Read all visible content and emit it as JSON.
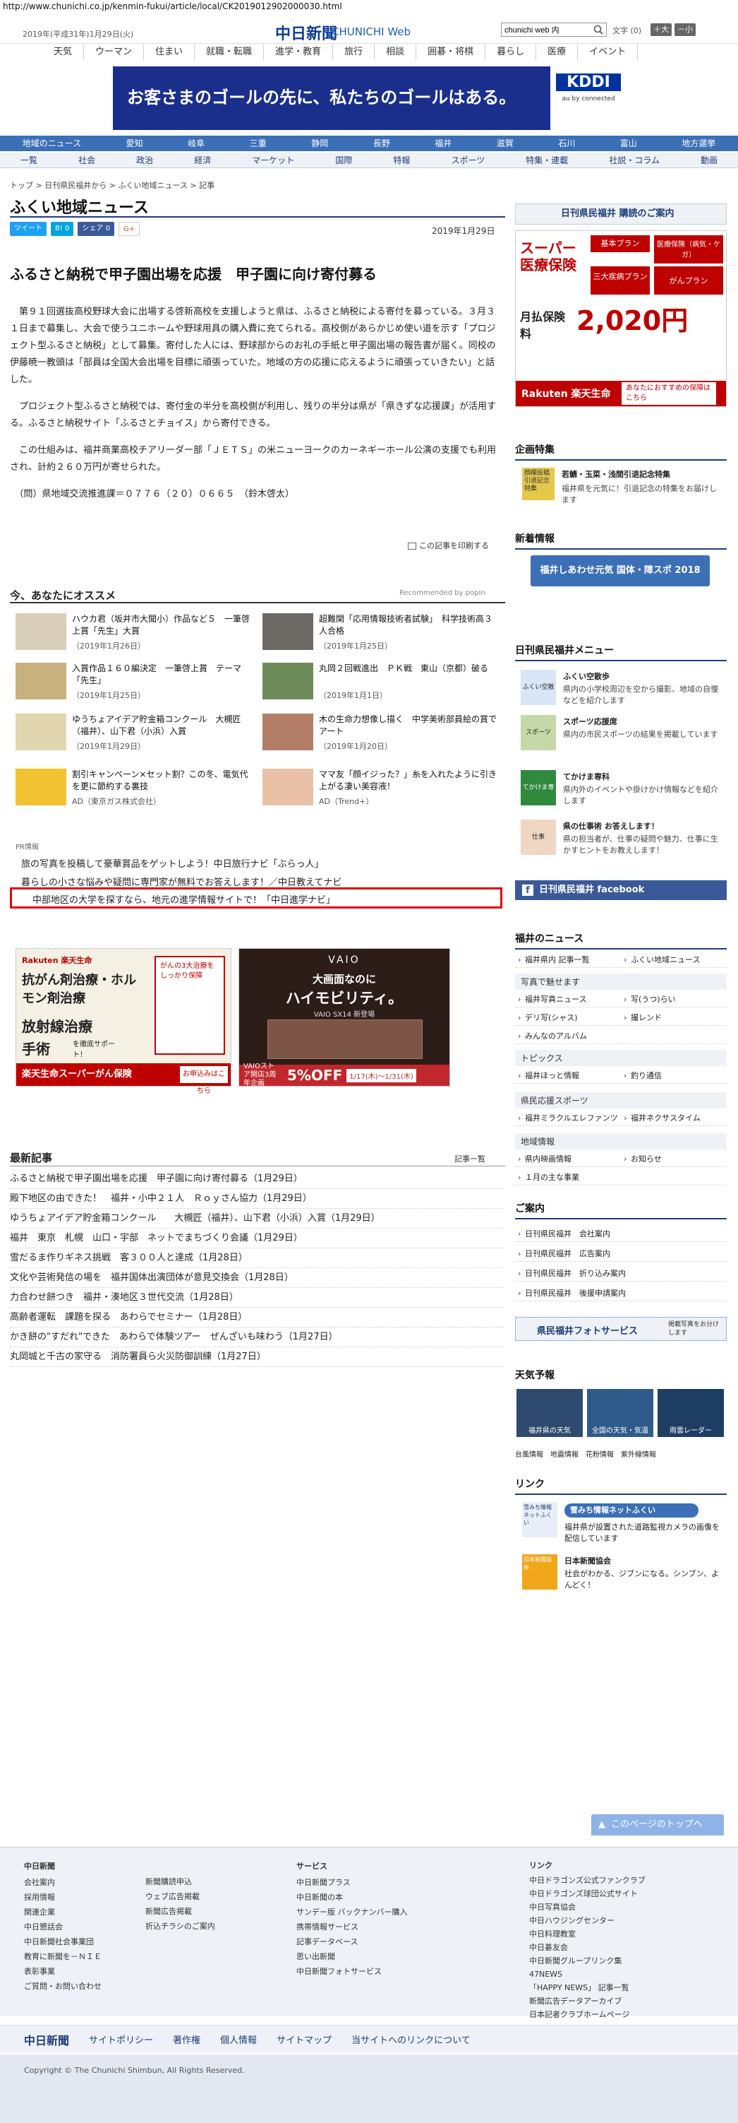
{
  "browser": {
    "url": "http://www.chunichi.co.jp/kenmin-fukui/article/local/CK2019012902000030.html"
  },
  "header": {
    "date": "2019年(平成31年)1月29日(火)",
    "logo_jp": "中日新聞",
    "logo_en": "CHUNICHI Web",
    "search_value": "chunichi web 内",
    "font_label": "文字",
    "font_count": "(0)",
    "font_bigger": "＋大",
    "font_smaller": "－小"
  },
  "topnav": [
    "天気",
    "ウーマン",
    "住まい",
    "就職・転職",
    "進学・教育",
    "旅行",
    "相談",
    "囲碁・将棋",
    "暮らし",
    "医療",
    "イベント"
  ],
  "banner": {
    "text": "お客さまのゴールの先に、私たちのゴールはある。",
    "brand": "KDDI",
    "brand_sub": "au by connected"
  },
  "regnav": [
    "地域のニュース",
    "愛知",
    "岐阜",
    "三重",
    "静岡",
    "長野",
    "福井",
    "滋賀",
    "石川",
    "富山",
    "地方選挙"
  ],
  "catnav": [
    "一覧",
    "社会",
    "政治",
    "経済",
    "マーケット",
    "国際",
    "特報",
    "スポーツ",
    "特集・連載",
    "社説・コラム",
    "動画"
  ],
  "breadcrumb": "トップ > 日刊県民福井から > ふくい地域ニュース > 記事",
  "page_heading": "ふくい地域ニュース",
  "social": {
    "tweet": "ツイート",
    "hatena": "B! 0",
    "fb": "シェア 0",
    "gplus": "G+"
  },
  "article": {
    "date": "2019年1月29日",
    "title": "ふるさと納税で甲子園出場を応援　甲子園に向け寄付募る",
    "p1": "　第９１回選抜高校野球大会に出場する啓新高校を支援しようと県は、ふるさと納税による寄付を募っている。３月３１日まで募集し、大会で使うユニホームや野球用具の購入費に充てられる。高校側があらかじめ使い道を示す「プロジェクト型ふるさと納税」として募集。寄付した人には、野球部からのお礼の手紙と甲子園出場の報告書が届く。同校の伊藤暁一教頭は「部員は全国大会出場を目標に頑張っていた。地域の方の応援に応えるように頑張っていきたい」と話した。",
    "p2": "　プロジェクト型ふるさと納税では、寄付金の半分を高校側が利用し、残りの半分は県が「県きずな応援課」が活用する。ふるさと納税サイト「ふるさとチョイス」から寄付できる。",
    "p3": "　この仕組みは、福井商業高校チアリーダー部「ＪＥＴＳ」の米ニューヨークのカーネギーホール公演の支援でも利用され、計約２６０万円が寄せられた。",
    "p4": "　（問）県地域交流推進課＝０７７６（２０）０６６５　（鈴木啓太）",
    "print": "この記事を印刷する"
  },
  "recommend": {
    "title": "今、あなたにオススメ",
    "by": "Recommended by popIn",
    "items": [
      {
        "title": "ハウカ君（坂井市大聞小）作品など５　一筆啓上賞「先生」大賞",
        "date": "（2019年1月26日）"
      },
      {
        "title": "超難関「応用情報技術者試験」　科学技術高３人合格",
        "date": "（2019年1月25日）"
      },
      {
        "title": "入賞作品１６０編決定　一筆啓上賞　テーマ「先生」",
        "date": "（2019年1月25日）"
      },
      {
        "title": "丸岡２回戦進出　ＰＫ戦　東山（京都）破る",
        "date": "（2019年1月1日）"
      },
      {
        "title": "ゆうちょアイデア貯金箱コンクール　大槻匠（福井）、山下君（小浜）入賞",
        "date": "（2019年1月29日）"
      },
      {
        "title": "木の生命力想像し描く　中学美術部員絵の賞でアート",
        "date": "（2019年1月20日）"
      },
      {
        "title": "割引キャンペーン×セット割？この冬、電気代を更に節約する裏技",
        "date": "AD（東京ガス株式会社）"
      },
      {
        "title": "ママ友「顔イジった？」糸を入れたように引き上がる凄い美容液！",
        "date": "AD（Trend+）"
      }
    ]
  },
  "pr": {
    "label": "PR情報",
    "items": [
      "旅の写真を投稿して豪華賞品をゲットしよう！中日旅行ナビ「ぶらっ人」",
      "暮らしの小さな悩みや疑問に専門家が無料でお答えします！／中日教えてナビ",
      "中部地区の大学を探すなら、地元の進学情報サイトで！「中日進学ナビ」"
    ]
  },
  "ads": {
    "ad1": {
      "brand": "Rakuten 楽天生命",
      "l1": "抗がん剤治療・ホルモン剤治療",
      "l2": "放射線治療",
      "l3": "手術",
      "l3b": "を徹底サポート！",
      "card": "がんの3大治療をしっかり保障",
      "product": "楽天生命スーパーがん保険",
      "cta": "お申込みはこちら"
    },
    "ad2": {
      "brand": "VAIO",
      "l1": "大画面なのに",
      "l2": "ハイモビリティ。",
      "model": "VAIO SX14 新登場",
      "promo": "VAIOストア開店3周年企画",
      "off": "5%OFF",
      "period": "1/17(木)～1/31(木)"
    }
  },
  "latest": {
    "title": "最新記事",
    "more": "記事一覧",
    "items": [
      "ふるさと納税で甲子園出場を応援　甲子園に向け寄付募る（1月29日）",
      "殿下地区の由できた！　福井・小中２１人　Ｒｏｙさん協力（1月29日）",
      "ゆうちょアイデア貯金箱コンクール　　大槻匠（福井）、山下君（小浜）入賞（1月29日）",
      "福井　東京　札幌　山口・宇部　ネットでまちづくり会議（1月29日）",
      "雪だるま作りギネス挑戦　客３００人と達成（1月28日）",
      "文化や芸術発信の場を　福井国体出演団体が意見交換会（1月28日）",
      "力合わせ餅つき　福井・湊地区３世代交流（1月28日）",
      "高齢者運転　課題を探る　あわらでセミナー（1月28日）",
      "かき餅の\"すだれ\"できた　あわらで体験ツアー　ぜんざいも味わう（1月27日）",
      "丸岡城と千古の家守る　消防署員ら火災防御訓練（1月27日）"
    ]
  },
  "right": {
    "subscribe": "日刊県民福井 購読のご案内",
    "ad_rakuten": {
      "l1": "スーパー",
      "l2": "医療保険",
      "tag1": "基本プラン",
      "tag2": "医療保険（病気・ケガ）",
      "tag3": "三大疾病プラン",
      "tag4": "がんプラン",
      "price_lbl": "月払保険料",
      "price": "2,020円",
      "brand": "Rakuten 楽天生命",
      "cta": "あなたにおすすめの保障はこちら"
    },
    "kikaku": {
      "title": "企画特集",
      "item_title": "若鯖・玉菜・浅間引退記念特集",
      "item_desc": "福井県を元気に！引退記念の特集をお届けします",
      "badge": "顔欄投稿 引退記念特集"
    },
    "newinfo": {
      "title": "新着情報",
      "banner": "福井しあわせ元気 国体・障スポ 2018"
    },
    "menu": {
      "title": "日刊県民福井メニュー",
      "items": [
        {
          "name": "ふくい空散歩",
          "desc": "県内の小学校周辺を空から撮影、地域の自慢などを紹介します",
          "badge": "ふくい空散歩"
        },
        {
          "name": "スポーツ応援席",
          "desc": "県内の市民スポーツの結果を掲載しています",
          "badge": "スポーツ"
        },
        {
          "name": "てかけま専科",
          "desc": "県内外のイベントや掛けかけ情報などを紹介します",
          "badge": "てかけま専科"
        },
        {
          "name": "県の仕事術 お答えします！",
          "desc": "県の担当者が、仕事の疑問や魅力、仕事に生かすヒントをお教えします！",
          "badge": "仕事"
        }
      ],
      "fb": "日刊県民福井 facebook"
    },
    "fukui_news": {
      "title": "福井のニュース",
      "row1": [
        "福井県内 記事一覧",
        "ふくい地域ニュース"
      ],
      "sec1": "写真で魅せます",
      "row2": [
        "福井写真ニュース",
        "写(うつ)らい"
      ],
      "row3": [
        "デリ写(シャス)",
        "撮レンド"
      ],
      "row4": [
        "みんなのアルバム"
      ],
      "sec2": "トピックス",
      "row5": [
        "福井ほっと情報",
        "釣り通信"
      ],
      "sec3": "県民応援スポーツ",
      "row6": [
        "福井ミラクルエレファンツ",
        "福井ネクサスタイム"
      ],
      "sec4": "地域情報",
      "row7": [
        "県内映画情報",
        "お知らせ"
      ],
      "row8": [
        "１月の主な事業"
      ]
    },
    "annai": {
      "title": "ご案内",
      "items": [
        "日刊県民福井　会社案内",
        "日刊県民福井　広告案内",
        "日刊県民福井　折り込み案内",
        "日刊県民福井　後援申請案内"
      ]
    },
    "photo": {
      "banner": "県民福井フォトサービス",
      "sub": "掲載写真をお分けします"
    },
    "weather": {
      "title": "天気予報",
      "t1": "福井県の天気",
      "t2": "全国の天気・気温",
      "t3": "雨雲レーダー",
      "links": [
        "台風情報",
        "地震情報",
        "花粉情報",
        "紫外線情報"
      ]
    },
    "links": {
      "title": "リンク",
      "l1_badge": "雪みち情報ネットふくい",
      "l1_desc": "福井県が設置された道路監視カメラの画像を配信しています",
      "l2_badge": "日本新聞協会",
      "l2_title": "日本新聞協会",
      "l2_desc": "社会がわかる、ジブンになる。シンブン、よんどく！"
    }
  },
  "totop": "このページのトップへ",
  "footer": {
    "col1": {
      "title": "中日新聞",
      "items": [
        "会社案内",
        "採用情報",
        "関連企業",
        "中日懇話会",
        "中日新聞社会事業団",
        "教育に新聞を－ＮＩＥ",
        "表彰事業",
        "ご質問・お問い合わせ"
      ]
    },
    "col2": {
      "items": [
        "新聞購読申込",
        "ウェブ広告掲載",
        "新聞広告掲載",
        "折込チラシのご案内"
      ]
    },
    "col3": {
      "title": "サービス",
      "items": [
        "中日新聞プラス",
        "中日新聞の本",
        "サンデー版 バックナンバー購入",
        "携帯情報サービス",
        "記事データベース",
        "思い出新聞",
        "中日新聞フォトサービス"
      ]
    },
    "col4": {
      "title": "リンク",
      "items": [
        "中日ドラゴンズ公式ファンクラブ",
        "中日ドラゴンズ球団公式サイト",
        "中日写真協会",
        "中日ハウジングセンター",
        "中日料理教室",
        "中日碁友会",
        "中日新聞グループリンク集",
        "47NEWS",
        "「HAPPY NEWS」 記事一覧",
        "新聞広告データアーカイブ",
        "日本記者クラブホームページ"
      ]
    },
    "bar": [
      "中日新聞",
      "サイトポリシー",
      "著作権",
      "個人情報",
      "サイトマップ",
      "当サイトへのリンクについて"
    ],
    "copyright": "Copyright © The Chunichi Shimbun, All Rights Reserved."
  },
  "colors": {
    "navy": "#1d3d7a",
    "blue": "#3b6fb6",
    "red": "#e30011",
    "rakuten": "#bf0000"
  }
}
